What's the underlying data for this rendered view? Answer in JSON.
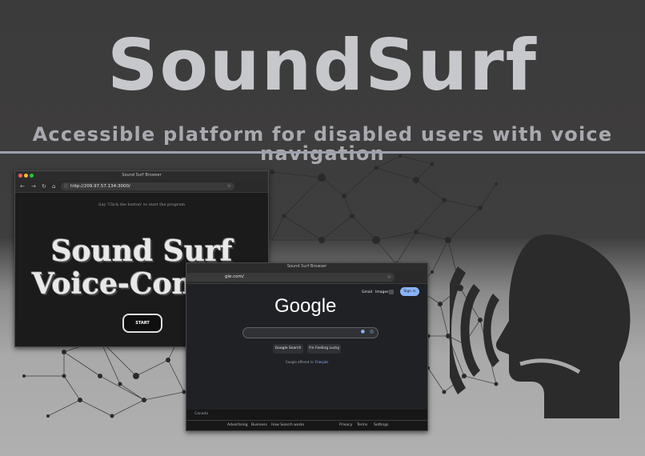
{
  "header": {
    "title": "SoundSurf",
    "subtitle": "Accessible platform for disabled users with voice navigation"
  },
  "app_window": {
    "title": "Sound Surf Browser",
    "url": "http://209.97.57.134:3000/",
    "instruction": "Say 'Click the button' to start the program",
    "heading_line1": "Sound Surf",
    "heading_line2": "Voice-Control",
    "start_label": "START"
  },
  "google_window": {
    "title": "Sound Surf Browser",
    "url": "gle.com/",
    "top_links": {
      "gmail": "Gmail",
      "images": "Images"
    },
    "signin_label": "Sign in",
    "logo_text": "Google",
    "search_button": "Google Search",
    "lucky_button": "I'm Feeling Lucky",
    "offered_in": "Google offered in:",
    "offered_language": "Français",
    "country": "Canada",
    "footer_left": [
      "Advertising",
      "Business",
      "How Search works"
    ],
    "footer_right": [
      "Privacy",
      "Terms",
      "Settings"
    ]
  },
  "colors": {
    "title": "#c7c8cc",
    "subtitle": "#a9aab0",
    "rule": "#9da0ae",
    "head": "#2b2b2b",
    "signin": "#8ab4f8"
  },
  "icons": [
    "back-arrow-icon",
    "forward-arrow-icon",
    "reload-icon",
    "home-icon",
    "lock-icon",
    "star-icon",
    "apps-grid-icon",
    "mic-icon",
    "lens-icon",
    "speaking-head-icon"
  ]
}
